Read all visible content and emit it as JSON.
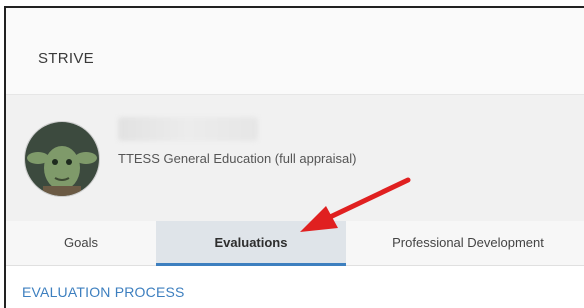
{
  "app": {
    "title": "STRIVE"
  },
  "profile": {
    "avatar_icon": "user-avatar-photo",
    "evaluation_type": "TTESS General Education (full appraisal)"
  },
  "tabs": [
    {
      "label": "Goals",
      "selected": false
    },
    {
      "label": "Evaluations",
      "selected": true
    },
    {
      "label": "Professional Development",
      "selected": false
    }
  ],
  "main": {
    "section_title": "EVALUATION PROCESS"
  },
  "colors": {
    "accent": "#3d7fbf",
    "annotation_arrow": "#e02020"
  }
}
